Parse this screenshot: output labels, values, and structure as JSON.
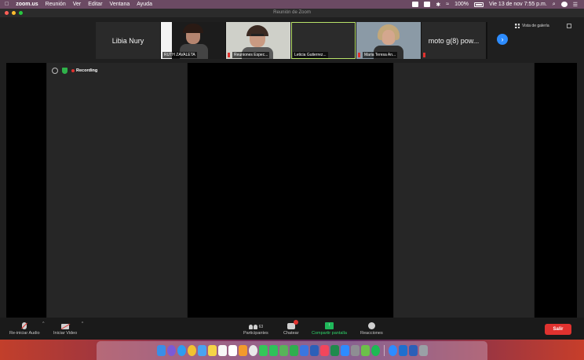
{
  "menubar": {
    "apple_icon": "apple-icon",
    "app_name": "zoom.us",
    "menus": [
      "Reunión",
      "Ver",
      "Editar",
      "Ventana",
      "Ayuda"
    ],
    "battery": "100%",
    "clock": "Vie 13 de nov  7:55 p.m."
  },
  "window": {
    "title": "Reunión de Zoom"
  },
  "participants_strip": {
    "tiles": [
      {
        "name": "Libia Nury",
        "kind": "name-only",
        "active": false
      },
      {
        "name": "RUTH ZAVALETA",
        "kind": "video",
        "active": false
      },
      {
        "name": "Reuniones Espec...",
        "kind": "video",
        "active": false
      },
      {
        "name": "Leticia Gutierrez...",
        "kind": "video",
        "active": true
      },
      {
        "name": "Maria Teresa An...",
        "kind": "video",
        "active": false
      },
      {
        "name": "moto g(8) pow...",
        "kind": "name-only",
        "active": false
      }
    ],
    "next_icon": "chevron-right-icon"
  },
  "view": {
    "gallery_label": "Vista de galería",
    "fullscreen_icon": "fullscreen-icon"
  },
  "status": {
    "recording_label": "Recording"
  },
  "toolbar": {
    "audio_label": "Re-iniciar Audio",
    "video_label": "Iniciar Video",
    "participants_label": "Participantes",
    "participants_count": "63",
    "chat_label": "Chatear",
    "share_label": "Compartir pantalla",
    "reactions_label": "Reacciones",
    "leave_label": "Salir"
  },
  "colors": {
    "accent_blue": "#2d8cff",
    "leave_red": "#e0322f",
    "share_green": "#2fd46a",
    "active_speaker": "#b9e36a"
  },
  "dock": {
    "icons": [
      "finder-icon",
      "siri-icon",
      "safari-icon",
      "chrome-icon",
      "mail-icon",
      "notes-icon",
      "calendar-icon",
      "reminders-icon",
      "pages-icon",
      "photos-icon",
      "messages-icon",
      "facetime-icon",
      "maps-icon",
      "numbers-icon",
      "keynote-icon",
      "word-icon",
      "music-icon",
      "excel-icon",
      "appstore-icon",
      "settings-icon",
      "preview-icon",
      "spotify-icon",
      "zoom-icon",
      "outlook-icon",
      "word-doc-icon",
      "trash-icon"
    ]
  }
}
